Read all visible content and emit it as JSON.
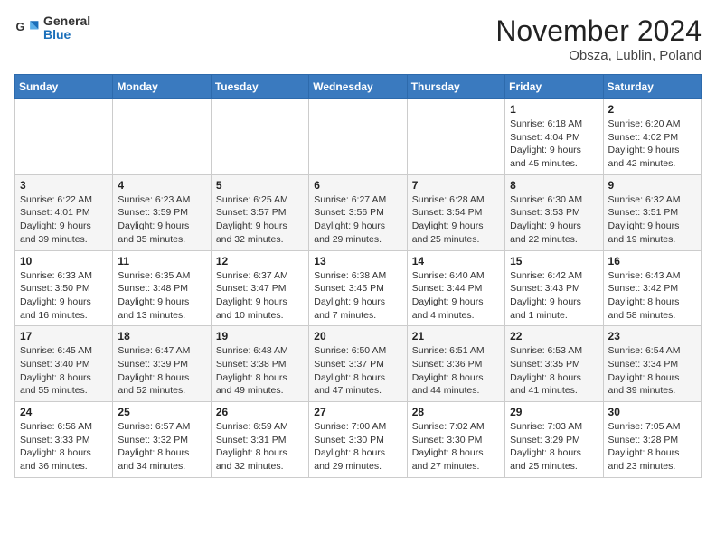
{
  "header": {
    "logo_general": "General",
    "logo_blue": "Blue",
    "month_title": "November 2024",
    "location": "Obsza, Lublin, Poland"
  },
  "days_of_week": [
    "Sunday",
    "Monday",
    "Tuesday",
    "Wednesday",
    "Thursday",
    "Friday",
    "Saturday"
  ],
  "weeks": [
    [
      {
        "day": "",
        "info": ""
      },
      {
        "day": "",
        "info": ""
      },
      {
        "day": "",
        "info": ""
      },
      {
        "day": "",
        "info": ""
      },
      {
        "day": "",
        "info": ""
      },
      {
        "day": "1",
        "info": "Sunrise: 6:18 AM\nSunset: 4:04 PM\nDaylight: 9 hours and 45 minutes."
      },
      {
        "day": "2",
        "info": "Sunrise: 6:20 AM\nSunset: 4:02 PM\nDaylight: 9 hours and 42 minutes."
      }
    ],
    [
      {
        "day": "3",
        "info": "Sunrise: 6:22 AM\nSunset: 4:01 PM\nDaylight: 9 hours and 39 minutes."
      },
      {
        "day": "4",
        "info": "Sunrise: 6:23 AM\nSunset: 3:59 PM\nDaylight: 9 hours and 35 minutes."
      },
      {
        "day": "5",
        "info": "Sunrise: 6:25 AM\nSunset: 3:57 PM\nDaylight: 9 hours and 32 minutes."
      },
      {
        "day": "6",
        "info": "Sunrise: 6:27 AM\nSunset: 3:56 PM\nDaylight: 9 hours and 29 minutes."
      },
      {
        "day": "7",
        "info": "Sunrise: 6:28 AM\nSunset: 3:54 PM\nDaylight: 9 hours and 25 minutes."
      },
      {
        "day": "8",
        "info": "Sunrise: 6:30 AM\nSunset: 3:53 PM\nDaylight: 9 hours and 22 minutes."
      },
      {
        "day": "9",
        "info": "Sunrise: 6:32 AM\nSunset: 3:51 PM\nDaylight: 9 hours and 19 minutes."
      }
    ],
    [
      {
        "day": "10",
        "info": "Sunrise: 6:33 AM\nSunset: 3:50 PM\nDaylight: 9 hours and 16 minutes."
      },
      {
        "day": "11",
        "info": "Sunrise: 6:35 AM\nSunset: 3:48 PM\nDaylight: 9 hours and 13 minutes."
      },
      {
        "day": "12",
        "info": "Sunrise: 6:37 AM\nSunset: 3:47 PM\nDaylight: 9 hours and 10 minutes."
      },
      {
        "day": "13",
        "info": "Sunrise: 6:38 AM\nSunset: 3:45 PM\nDaylight: 9 hours and 7 minutes."
      },
      {
        "day": "14",
        "info": "Sunrise: 6:40 AM\nSunset: 3:44 PM\nDaylight: 9 hours and 4 minutes."
      },
      {
        "day": "15",
        "info": "Sunrise: 6:42 AM\nSunset: 3:43 PM\nDaylight: 9 hours and 1 minute."
      },
      {
        "day": "16",
        "info": "Sunrise: 6:43 AM\nSunset: 3:42 PM\nDaylight: 8 hours and 58 minutes."
      }
    ],
    [
      {
        "day": "17",
        "info": "Sunrise: 6:45 AM\nSunset: 3:40 PM\nDaylight: 8 hours and 55 minutes."
      },
      {
        "day": "18",
        "info": "Sunrise: 6:47 AM\nSunset: 3:39 PM\nDaylight: 8 hours and 52 minutes."
      },
      {
        "day": "19",
        "info": "Sunrise: 6:48 AM\nSunset: 3:38 PM\nDaylight: 8 hours and 49 minutes."
      },
      {
        "day": "20",
        "info": "Sunrise: 6:50 AM\nSunset: 3:37 PM\nDaylight: 8 hours and 47 minutes."
      },
      {
        "day": "21",
        "info": "Sunrise: 6:51 AM\nSunset: 3:36 PM\nDaylight: 8 hours and 44 minutes."
      },
      {
        "day": "22",
        "info": "Sunrise: 6:53 AM\nSunset: 3:35 PM\nDaylight: 8 hours and 41 minutes."
      },
      {
        "day": "23",
        "info": "Sunrise: 6:54 AM\nSunset: 3:34 PM\nDaylight: 8 hours and 39 minutes."
      }
    ],
    [
      {
        "day": "24",
        "info": "Sunrise: 6:56 AM\nSunset: 3:33 PM\nDaylight: 8 hours and 36 minutes."
      },
      {
        "day": "25",
        "info": "Sunrise: 6:57 AM\nSunset: 3:32 PM\nDaylight: 8 hours and 34 minutes."
      },
      {
        "day": "26",
        "info": "Sunrise: 6:59 AM\nSunset: 3:31 PM\nDaylight: 8 hours and 32 minutes."
      },
      {
        "day": "27",
        "info": "Sunrise: 7:00 AM\nSunset: 3:30 PM\nDaylight: 8 hours and 29 minutes."
      },
      {
        "day": "28",
        "info": "Sunrise: 7:02 AM\nSunset: 3:30 PM\nDaylight: 8 hours and 27 minutes."
      },
      {
        "day": "29",
        "info": "Sunrise: 7:03 AM\nSunset: 3:29 PM\nDaylight: 8 hours and 25 minutes."
      },
      {
        "day": "30",
        "info": "Sunrise: 7:05 AM\nSunset: 3:28 PM\nDaylight: 8 hours and 23 minutes."
      }
    ]
  ]
}
